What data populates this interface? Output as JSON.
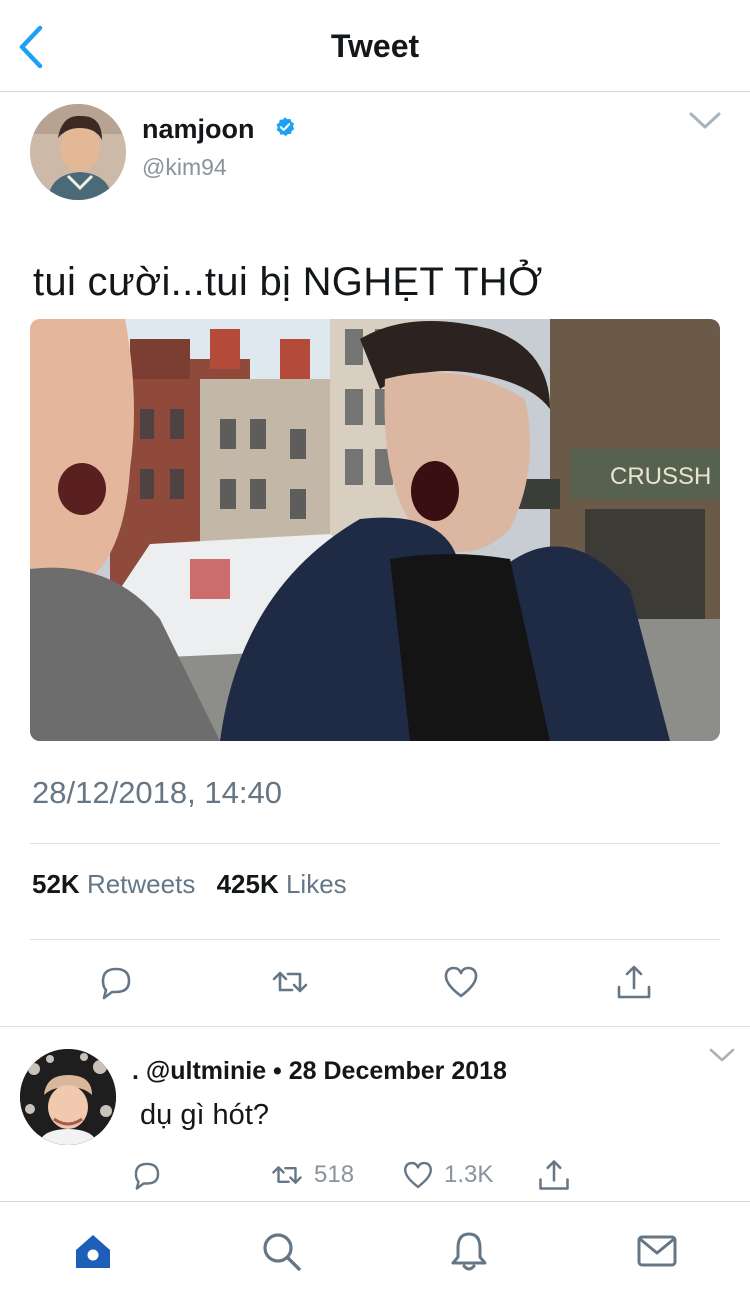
{
  "header": {
    "title": "Tweet"
  },
  "tweet": {
    "author_name": "namjoon",
    "author_handle": "@kim94",
    "text": "tui cười...tui bị NGHẸT THỞ",
    "timestamp": "28/12/2018, 14:40",
    "retweets_count": "52K",
    "retweets_label": "Retweets",
    "likes_count": "425K",
    "likes_label": "Likes",
    "media_sign_text": "CRUSSH"
  },
  "reply": {
    "meta": ". @ultminie • 28 December 2018",
    "text": "dụ gì hót?",
    "retweet_count": "518",
    "like_count": "1.3K"
  },
  "colors": {
    "accent": "#1da1f2",
    "active_tab": "#1d5fb8",
    "icon_gray": "#657786"
  },
  "tabs": [
    "home-icon",
    "search-icon",
    "notifications-icon",
    "messages-icon"
  ]
}
